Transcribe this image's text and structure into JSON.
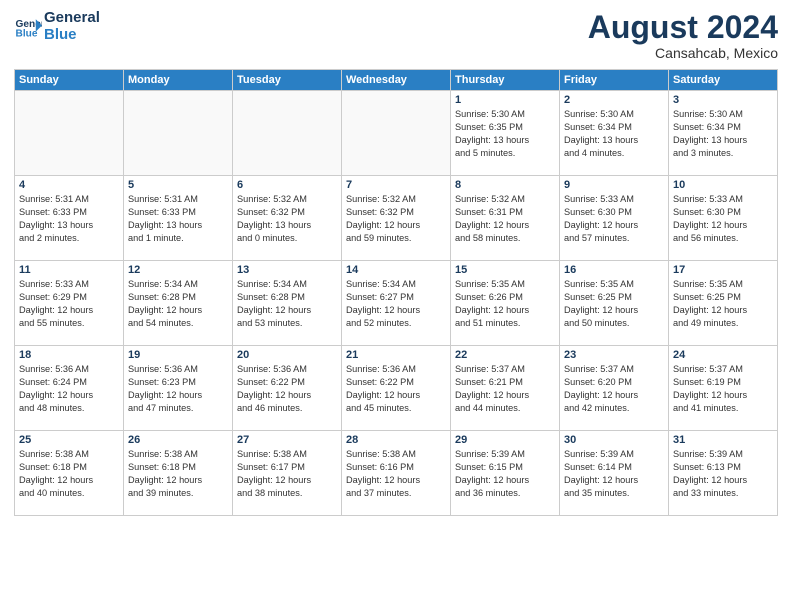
{
  "header": {
    "logo_text_general": "General",
    "logo_text_blue": "Blue",
    "month_year": "August 2024",
    "location": "Cansahcab, Mexico"
  },
  "weekdays": [
    "Sunday",
    "Monday",
    "Tuesday",
    "Wednesday",
    "Thursday",
    "Friday",
    "Saturday"
  ],
  "weeks": [
    [
      {
        "day": "",
        "info": ""
      },
      {
        "day": "",
        "info": ""
      },
      {
        "day": "",
        "info": ""
      },
      {
        "day": "",
        "info": ""
      },
      {
        "day": "1",
        "info": "Sunrise: 5:30 AM\nSunset: 6:35 PM\nDaylight: 13 hours\nand 5 minutes."
      },
      {
        "day": "2",
        "info": "Sunrise: 5:30 AM\nSunset: 6:34 PM\nDaylight: 13 hours\nand 4 minutes."
      },
      {
        "day": "3",
        "info": "Sunrise: 5:30 AM\nSunset: 6:34 PM\nDaylight: 13 hours\nand 3 minutes."
      }
    ],
    [
      {
        "day": "4",
        "info": "Sunrise: 5:31 AM\nSunset: 6:33 PM\nDaylight: 13 hours\nand 2 minutes."
      },
      {
        "day": "5",
        "info": "Sunrise: 5:31 AM\nSunset: 6:33 PM\nDaylight: 13 hours\nand 1 minute."
      },
      {
        "day": "6",
        "info": "Sunrise: 5:32 AM\nSunset: 6:32 PM\nDaylight: 13 hours\nand 0 minutes."
      },
      {
        "day": "7",
        "info": "Sunrise: 5:32 AM\nSunset: 6:32 PM\nDaylight: 12 hours\nand 59 minutes."
      },
      {
        "day": "8",
        "info": "Sunrise: 5:32 AM\nSunset: 6:31 PM\nDaylight: 12 hours\nand 58 minutes."
      },
      {
        "day": "9",
        "info": "Sunrise: 5:33 AM\nSunset: 6:30 PM\nDaylight: 12 hours\nand 57 minutes."
      },
      {
        "day": "10",
        "info": "Sunrise: 5:33 AM\nSunset: 6:30 PM\nDaylight: 12 hours\nand 56 minutes."
      }
    ],
    [
      {
        "day": "11",
        "info": "Sunrise: 5:33 AM\nSunset: 6:29 PM\nDaylight: 12 hours\nand 55 minutes."
      },
      {
        "day": "12",
        "info": "Sunrise: 5:34 AM\nSunset: 6:28 PM\nDaylight: 12 hours\nand 54 minutes."
      },
      {
        "day": "13",
        "info": "Sunrise: 5:34 AM\nSunset: 6:28 PM\nDaylight: 12 hours\nand 53 minutes."
      },
      {
        "day": "14",
        "info": "Sunrise: 5:34 AM\nSunset: 6:27 PM\nDaylight: 12 hours\nand 52 minutes."
      },
      {
        "day": "15",
        "info": "Sunrise: 5:35 AM\nSunset: 6:26 PM\nDaylight: 12 hours\nand 51 minutes."
      },
      {
        "day": "16",
        "info": "Sunrise: 5:35 AM\nSunset: 6:25 PM\nDaylight: 12 hours\nand 50 minutes."
      },
      {
        "day": "17",
        "info": "Sunrise: 5:35 AM\nSunset: 6:25 PM\nDaylight: 12 hours\nand 49 minutes."
      }
    ],
    [
      {
        "day": "18",
        "info": "Sunrise: 5:36 AM\nSunset: 6:24 PM\nDaylight: 12 hours\nand 48 minutes."
      },
      {
        "day": "19",
        "info": "Sunrise: 5:36 AM\nSunset: 6:23 PM\nDaylight: 12 hours\nand 47 minutes."
      },
      {
        "day": "20",
        "info": "Sunrise: 5:36 AM\nSunset: 6:22 PM\nDaylight: 12 hours\nand 46 minutes."
      },
      {
        "day": "21",
        "info": "Sunrise: 5:36 AM\nSunset: 6:22 PM\nDaylight: 12 hours\nand 45 minutes."
      },
      {
        "day": "22",
        "info": "Sunrise: 5:37 AM\nSunset: 6:21 PM\nDaylight: 12 hours\nand 44 minutes."
      },
      {
        "day": "23",
        "info": "Sunrise: 5:37 AM\nSunset: 6:20 PM\nDaylight: 12 hours\nand 42 minutes."
      },
      {
        "day": "24",
        "info": "Sunrise: 5:37 AM\nSunset: 6:19 PM\nDaylight: 12 hours\nand 41 minutes."
      }
    ],
    [
      {
        "day": "25",
        "info": "Sunrise: 5:38 AM\nSunset: 6:18 PM\nDaylight: 12 hours\nand 40 minutes."
      },
      {
        "day": "26",
        "info": "Sunrise: 5:38 AM\nSunset: 6:18 PM\nDaylight: 12 hours\nand 39 minutes."
      },
      {
        "day": "27",
        "info": "Sunrise: 5:38 AM\nSunset: 6:17 PM\nDaylight: 12 hours\nand 38 minutes."
      },
      {
        "day": "28",
        "info": "Sunrise: 5:38 AM\nSunset: 6:16 PM\nDaylight: 12 hours\nand 37 minutes."
      },
      {
        "day": "29",
        "info": "Sunrise: 5:39 AM\nSunset: 6:15 PM\nDaylight: 12 hours\nand 36 minutes."
      },
      {
        "day": "30",
        "info": "Sunrise: 5:39 AM\nSunset: 6:14 PM\nDaylight: 12 hours\nand 35 minutes."
      },
      {
        "day": "31",
        "info": "Sunrise: 5:39 AM\nSunset: 6:13 PM\nDaylight: 12 hours\nand 33 minutes."
      }
    ]
  ]
}
